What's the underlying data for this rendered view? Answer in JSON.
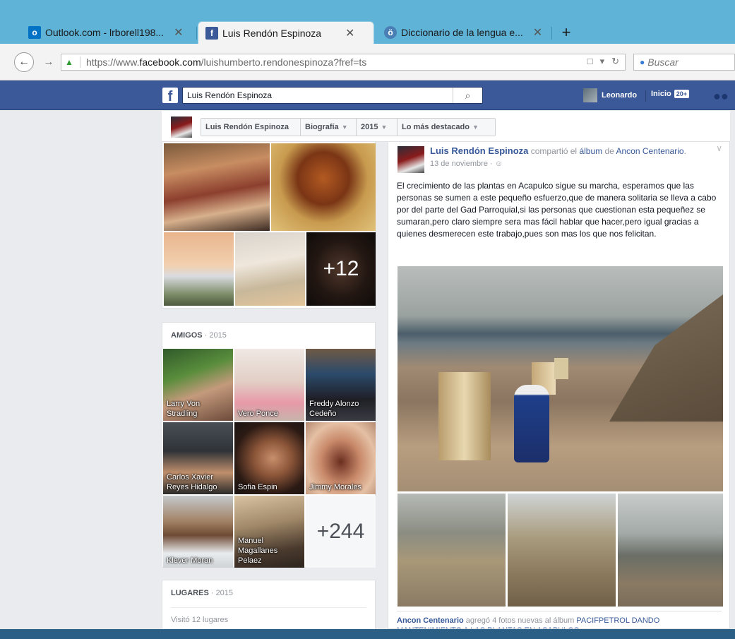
{
  "browser": {
    "tabs": [
      {
        "label": "Outlook.com - lrborell198...",
        "icon": "outlook-icon",
        "color": "#0072c6"
      },
      {
        "label": "Luis Rendón Espinoza",
        "icon": "facebook-icon",
        "color": "#3b5998"
      },
      {
        "label": "Diccionario de la lengua e...",
        "icon": "rae-icon",
        "color": "#4a7fb5"
      }
    ],
    "new_tab": "+",
    "url_prefix": "https://www.",
    "url_domain": "facebook.com",
    "url_path": "/luishumberto.rendonespinoza?fref=ts",
    "search_placeholder": "Buscar",
    "close_glyph": "✕"
  },
  "fb": {
    "search_value": "Luis Rendón Espinoza",
    "user_name": "Leonardo",
    "home_label": "Inicio",
    "home_badge": "20+",
    "brand_color": "#3b5998"
  },
  "timeline_nav": {
    "name": "Luis Rendón Espinoza",
    "bio": "Biografía",
    "year": "2015",
    "highlights": "Lo más destacado"
  },
  "photos": {
    "more_count": "+12"
  },
  "friends": {
    "heading": "AMIGOS",
    "year": "· 2015",
    "items": [
      {
        "name": "Larry Von Stradling"
      },
      {
        "name": "Vero Ponce"
      },
      {
        "name": "Freddy Alonzo Cedeño"
      },
      {
        "name": "Carlos Xavier Reyes Hidalgo"
      },
      {
        "name": "Sofia Espin"
      },
      {
        "name": "Jimmy Morales"
      },
      {
        "name": "Klever Moran"
      },
      {
        "name": "Manuel Magallanes Pelaez"
      }
    ],
    "more_count": "+244"
  },
  "places": {
    "heading": "LUGARES",
    "year": "· 2015",
    "text": "Visitó 12 lugares"
  },
  "post": {
    "author": "Luis Rendón Espinoza",
    "action": " compartió el ",
    "album_word": "álbum",
    "of_word": " de ",
    "page": "Ancon Centenario",
    "period": ".",
    "date": "13 de noviembre · ",
    "audience_icon": "friends-audience-icon",
    "text": "El crecimiento de las plantas en Acapulco sigue su marcha, esperamos que las personas se sumen a este pequeño esfuerzo,que de manera solitaria se lleva a cabo por del parte del Gad Parroquial,si las personas que cuestionan esta pequeñez se sumaran,pero claro siempre sera mas fácil hablar que hacer,pero igual gracias a quienes desmerecen este trabajo,pues son mas los que nos felicitan.",
    "footer_page": "Ancon Centenario",
    "footer_text": " agregó 4 fotos nuevas al álbum ",
    "footer_album": "PACIFPETROL DANDO MANTENIMIENTO A LAS PLANTAS EN ACAPULCO."
  }
}
